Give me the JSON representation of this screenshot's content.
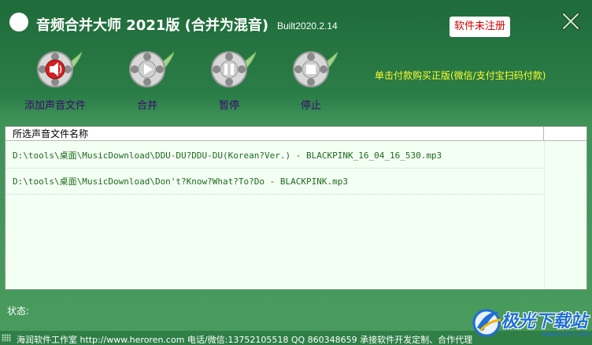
{
  "window": {
    "title": "音频合并大师 2021版 (合并为混音)",
    "build": "Built2020.2.14",
    "registration_badge": "软件未注册",
    "close_icon": "close-x-icon"
  },
  "toolbar": {
    "items": [
      {
        "label": "添加声音文件",
        "icon": "film-reel-speaker-icon",
        "accent": "#d42020"
      },
      {
        "label": "合并",
        "icon": "film-reel-play-icon",
        "accent": "#d8d8d8"
      },
      {
        "label": "暂停",
        "icon": "film-reel-pause-icon",
        "accent": "#d8d8d8"
      },
      {
        "label": "停止",
        "icon": "film-reel-stop-icon",
        "accent": "#d8d8d8"
      }
    ],
    "promo_text": "单击付款购买正版(微信/支付宝扫码付款)"
  },
  "list": {
    "header": "所选声音文件名称",
    "rows": [
      "D:\\tools\\桌面\\MusicDownload\\DDU-DU?DDU-DU(Korean?Ver.) - BLACKPINK_16_04_16_530.mp3",
      "D:\\tools\\桌面\\MusicDownload\\Don't?Know?What?To?Do - BLACKPINK.mp3"
    ]
  },
  "status": {
    "label": "状态:"
  },
  "footer": {
    "text": "海润软件工作室 http://www.heroren.com  电话/微信:13752105518  QQ 860348659 承接软件开发定制、合作代理"
  },
  "watermark": {
    "text": "极光下载站",
    "url": "www.xz7.com"
  },
  "colors": {
    "title_bar": "#1f6b3a",
    "body_green": "#4a9b5e",
    "tool_label": "#3a0a6e",
    "promo": "#ffff2a",
    "row_text": "#1e6b1e",
    "badge_text": "#d40000"
  }
}
